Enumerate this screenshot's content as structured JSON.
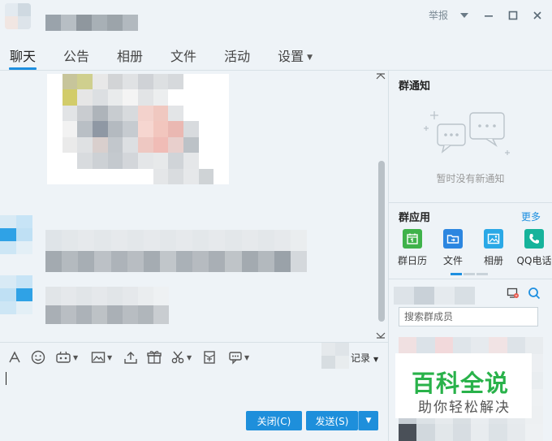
{
  "window": {
    "report_label": "举报",
    "controls": [
      "dropdown",
      "minimize",
      "maximize",
      "close"
    ]
  },
  "tabs": [
    {
      "label": "聊天",
      "active": true
    },
    {
      "label": "公告"
    },
    {
      "label": "相册"
    },
    {
      "label": "文件"
    },
    {
      "label": "活动"
    },
    {
      "label": "设置",
      "has_dropdown": true
    }
  ],
  "toolbar": {
    "tools": [
      "font-icon",
      "emoji-icon",
      "gif-icon",
      "image-icon",
      "upload-icon",
      "gift-icon",
      "screenshot-icon",
      "red-packet-icon",
      "more-icon"
    ],
    "record_label": "记录"
  },
  "buttons": {
    "close_label": "关闭(C)",
    "send_label": "发送(S)"
  },
  "group_notice": {
    "title": "群通知",
    "empty_text": "暂时没有新通知"
  },
  "group_apps": {
    "title": "群应用",
    "more_label": "更多",
    "items": [
      {
        "label": "群日历",
        "icon": "calendar-icon",
        "color": "#3fb24a"
      },
      {
        "label": "文件",
        "icon": "folder-icon",
        "color": "#2c86e0"
      },
      {
        "label": "相册",
        "icon": "photo-icon",
        "color": "#2aa8e6"
      },
      {
        "label": "QQ电话",
        "icon": "phone-icon",
        "color": "#16b39b"
      }
    ]
  },
  "members": {
    "search_placeholder": "搜索群成员"
  },
  "watermark": {
    "big": "百科全说",
    "small": "助你轻松解决"
  },
  "colors": {
    "accent": "#1d8fe0",
    "button": "#1e8fdb",
    "background": "#eef3f7"
  }
}
